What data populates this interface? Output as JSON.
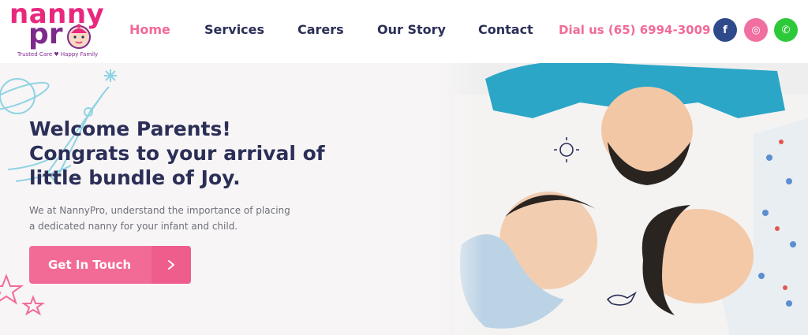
{
  "header": {
    "logo": {
      "word1": "nanny",
      "word2": "pr",
      "tagline": "Trusted Care ♥ Happy Family",
      "brand_pink": "#e8287e",
      "brand_purple": "#7d2a8c"
    },
    "nav": [
      {
        "label": "Home",
        "active": true
      },
      {
        "label": "Services",
        "active": false
      },
      {
        "label": "Carers",
        "active": false
      },
      {
        "label": "Our Story",
        "active": false
      },
      {
        "label": "Contact",
        "active": false
      }
    ],
    "dial": "Dial us (65) 6994-3009",
    "social": [
      {
        "icon": "facebook-icon",
        "glyph": "f",
        "color": "#2f4a8a"
      },
      {
        "icon": "instagram-icon",
        "glyph": "◎",
        "color": "#f06fa0"
      },
      {
        "icon": "whatsapp-icon",
        "glyph": "✆",
        "color": "#2ec93a"
      }
    ]
  },
  "hero": {
    "headline": [
      "Welcome Parents!",
      "Congrats to your arrival of",
      "little bundle of Joy."
    ],
    "body": "We at NannyPro, understand the importance of placing a dedicated nanny for your infant and child.",
    "cta": {
      "label": "Get In Touch",
      "arrow_glyph": "›"
    },
    "colors": {
      "heading": "#2b2f57",
      "accent": "#f26b96",
      "text": "#6f6f7a"
    }
  }
}
